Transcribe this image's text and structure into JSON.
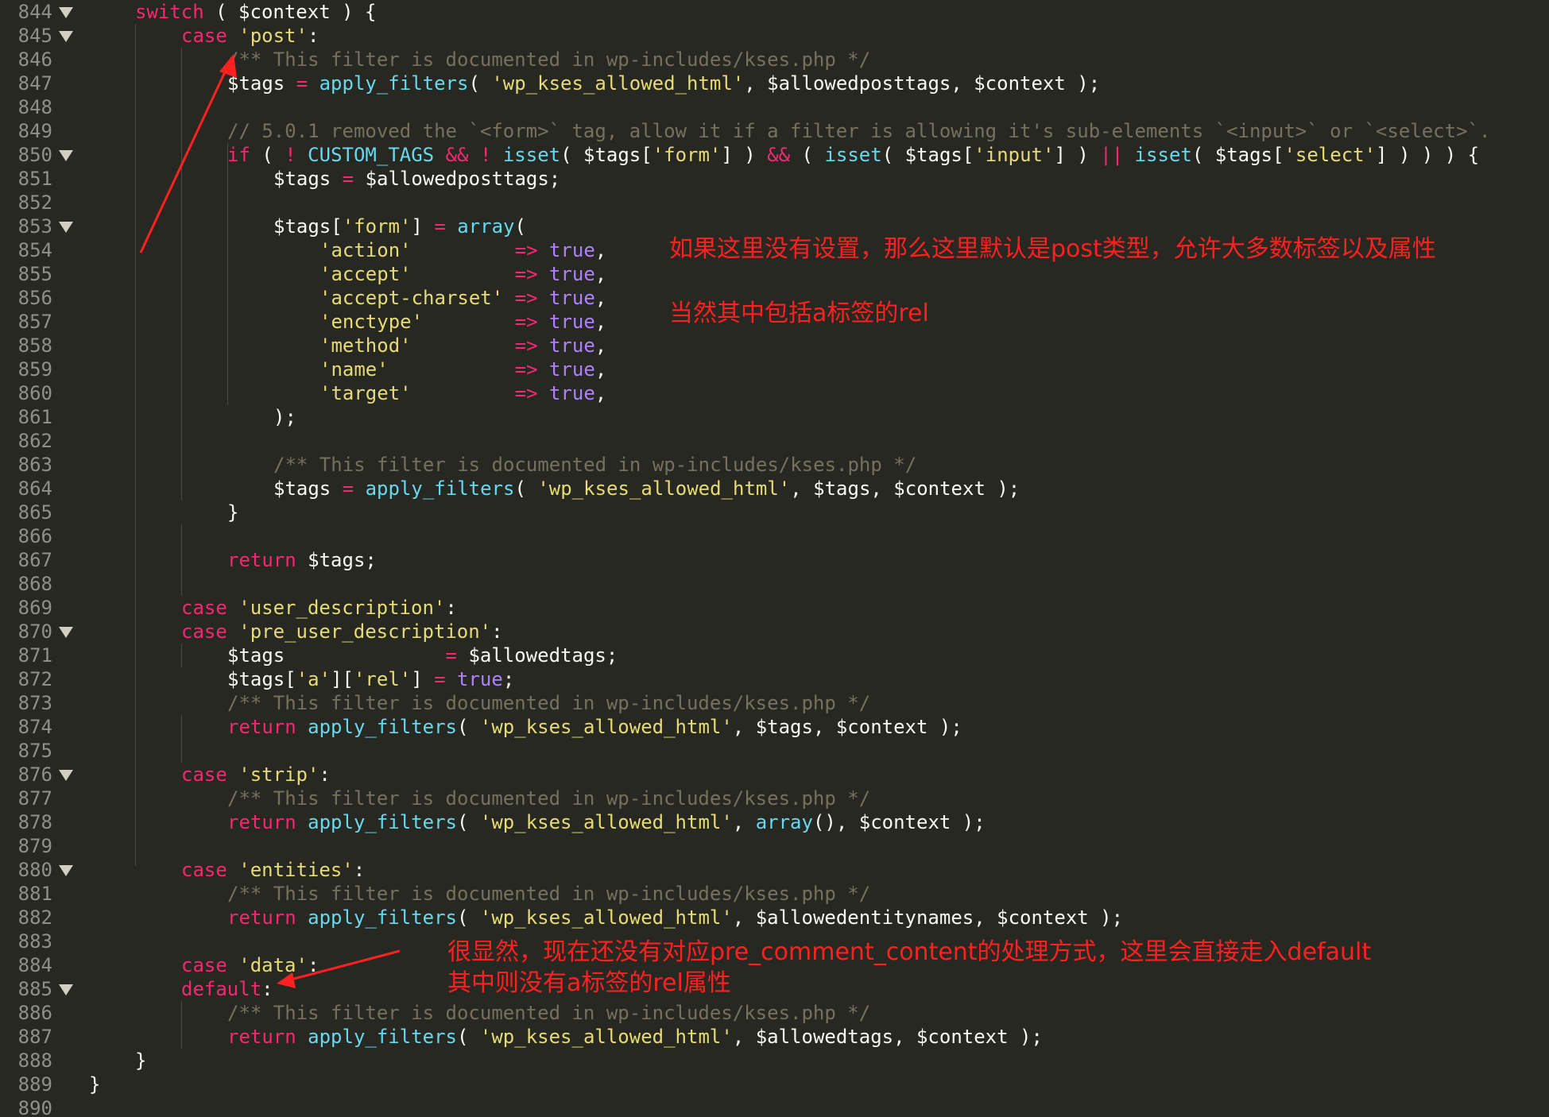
{
  "colors": {
    "background": "#272822",
    "line_number": "#90908a",
    "keyword": "#f92672",
    "string": "#e6db74",
    "function": "#66d9ef",
    "comment": "#75715e",
    "variable": "#f8f8f2",
    "constant": "#ae81ff",
    "annotation": "#ff2020"
  },
  "icons": {
    "fold_marker": "fold-triangle-down-icon",
    "annotation_arrow": "red-arrow-icon"
  },
  "lines": [
    {
      "n": "844",
      "fold": true,
      "tokens": [
        [
          "kw",
          "switch"
        ],
        [
          "var",
          " ( $context ) {"
        ]
      ]
    },
    {
      "n": "845",
      "fold": true,
      "tokens": [
        [
          "kw",
          "case"
        ],
        [
          "var",
          " "
        ],
        [
          "str",
          "'post'"
        ],
        [
          "var",
          ":"
        ]
      ]
    },
    {
      "n": "846",
      "fold": false,
      "tokens": [
        [
          "cm",
          "/** This filter is documented in wp-includes/kses.php */"
        ]
      ]
    },
    {
      "n": "847",
      "fold": false,
      "tokens": [
        [
          "var",
          "$tags "
        ],
        [
          "op",
          "="
        ],
        [
          "var",
          " "
        ],
        [
          "fn",
          "apply_filters"
        ],
        [
          "var",
          "( "
        ],
        [
          "str",
          "'wp_kses_allowed_html'"
        ],
        [
          "var",
          ", $allowedposttags, $context );"
        ]
      ]
    },
    {
      "n": "848",
      "fold": false,
      "tokens": []
    },
    {
      "n": "849",
      "fold": false,
      "tokens": [
        [
          "cm",
          "// 5.0.1 removed the `<form>` tag, allow it if a filter is allowing it's sub-elements `<input>` or `<select>`."
        ]
      ]
    },
    {
      "n": "850",
      "fold": true,
      "tokens": [
        [
          "kw",
          "if"
        ],
        [
          "var",
          " ( "
        ],
        [
          "op",
          "!"
        ],
        [
          "var",
          " "
        ],
        [
          "fn",
          "CUSTOM_TAGS"
        ],
        [
          "var",
          " "
        ],
        [
          "op",
          "&&"
        ],
        [
          "var",
          " "
        ],
        [
          "op",
          "!"
        ],
        [
          "var",
          " "
        ],
        [
          "fn",
          "isset"
        ],
        [
          "var",
          "( $tags["
        ],
        [
          "str",
          "'form'"
        ],
        [
          "var",
          "] ) "
        ],
        [
          "op",
          "&&"
        ],
        [
          "var",
          " ( "
        ],
        [
          "fn",
          "isset"
        ],
        [
          "var",
          "( $tags["
        ],
        [
          "str",
          "'input'"
        ],
        [
          "var",
          "] ) "
        ],
        [
          "op",
          "||"
        ],
        [
          "var",
          " "
        ],
        [
          "fn",
          "isset"
        ],
        [
          "var",
          "( $tags["
        ],
        [
          "str",
          "'select'"
        ],
        [
          "var",
          "] ) ) ) {"
        ]
      ]
    },
    {
      "n": "851",
      "fold": false,
      "tokens": [
        [
          "var",
          "$tags "
        ],
        [
          "op",
          "="
        ],
        [
          "var",
          " $allowedposttags;"
        ]
      ]
    },
    {
      "n": "852",
      "fold": false,
      "tokens": []
    },
    {
      "n": "853",
      "fold": true,
      "tokens": [
        [
          "var",
          "$tags["
        ],
        [
          "str",
          "'form'"
        ],
        [
          "var",
          "] "
        ],
        [
          "op",
          "="
        ],
        [
          "var",
          " "
        ],
        [
          "fn",
          "array"
        ],
        [
          "var",
          "("
        ]
      ]
    },
    {
      "n": "854",
      "fold": false,
      "tokens": [
        [
          "str",
          "'action'"
        ],
        [
          "var",
          "         "
        ],
        [
          "op",
          "=>"
        ],
        [
          "var",
          " "
        ],
        [
          "const",
          "true"
        ],
        [
          "var",
          ","
        ]
      ]
    },
    {
      "n": "855",
      "fold": false,
      "tokens": [
        [
          "str",
          "'accept'"
        ],
        [
          "var",
          "         "
        ],
        [
          "op",
          "=>"
        ],
        [
          "var",
          " "
        ],
        [
          "const",
          "true"
        ],
        [
          "var",
          ","
        ]
      ]
    },
    {
      "n": "856",
      "fold": false,
      "tokens": [
        [
          "str",
          "'accept-charset'"
        ],
        [
          "var",
          " "
        ],
        [
          "op",
          "=>"
        ],
        [
          "var",
          " "
        ],
        [
          "const",
          "true"
        ],
        [
          "var",
          ","
        ]
      ]
    },
    {
      "n": "857",
      "fold": false,
      "tokens": [
        [
          "str",
          "'enctype'"
        ],
        [
          "var",
          "        "
        ],
        [
          "op",
          "=>"
        ],
        [
          "var",
          " "
        ],
        [
          "const",
          "true"
        ],
        [
          "var",
          ","
        ]
      ]
    },
    {
      "n": "858",
      "fold": false,
      "tokens": [
        [
          "str",
          "'method'"
        ],
        [
          "var",
          "         "
        ],
        [
          "op",
          "=>"
        ],
        [
          "var",
          " "
        ],
        [
          "const",
          "true"
        ],
        [
          "var",
          ","
        ]
      ]
    },
    {
      "n": "859",
      "fold": false,
      "tokens": [
        [
          "str",
          "'name'"
        ],
        [
          "var",
          "           "
        ],
        [
          "op",
          "=>"
        ],
        [
          "var",
          " "
        ],
        [
          "const",
          "true"
        ],
        [
          "var",
          ","
        ]
      ]
    },
    {
      "n": "860",
      "fold": false,
      "tokens": [
        [
          "str",
          "'target'"
        ],
        [
          "var",
          "         "
        ],
        [
          "op",
          "=>"
        ],
        [
          "var",
          " "
        ],
        [
          "const",
          "true"
        ],
        [
          "var",
          ","
        ]
      ]
    },
    {
      "n": "861",
      "fold": false,
      "tokens": [
        [
          "var",
          ");"
        ]
      ]
    },
    {
      "n": "862",
      "fold": false,
      "tokens": []
    },
    {
      "n": "863",
      "fold": false,
      "tokens": [
        [
          "cm",
          "/** This filter is documented in wp-includes/kses.php */"
        ]
      ]
    },
    {
      "n": "864",
      "fold": false,
      "tokens": [
        [
          "var",
          "$tags "
        ],
        [
          "op",
          "="
        ],
        [
          "var",
          " "
        ],
        [
          "fn",
          "apply_filters"
        ],
        [
          "var",
          "( "
        ],
        [
          "str",
          "'wp_kses_allowed_html'"
        ],
        [
          "var",
          ", $tags, $context );"
        ]
      ]
    },
    {
      "n": "865",
      "fold": false,
      "tokens": [
        [
          "var",
          "}"
        ]
      ]
    },
    {
      "n": "866",
      "fold": false,
      "tokens": []
    },
    {
      "n": "867",
      "fold": false,
      "tokens": [
        [
          "kw",
          "return"
        ],
        [
          "var",
          " $tags;"
        ]
      ]
    },
    {
      "n": "868",
      "fold": false,
      "tokens": []
    },
    {
      "n": "869",
      "fold": false,
      "tokens": [
        [
          "kw",
          "case"
        ],
        [
          "var",
          " "
        ],
        [
          "str",
          "'user_description'"
        ],
        [
          "var",
          ":"
        ]
      ]
    },
    {
      "n": "870",
      "fold": true,
      "tokens": [
        [
          "kw",
          "case"
        ],
        [
          "var",
          " "
        ],
        [
          "str",
          "'pre_user_description'"
        ],
        [
          "var",
          ":"
        ]
      ]
    },
    {
      "n": "871",
      "fold": false,
      "tokens": [
        [
          "var",
          "$tags              "
        ],
        [
          "op",
          "="
        ],
        [
          "var",
          " $allowedtags;"
        ]
      ]
    },
    {
      "n": "872",
      "fold": false,
      "tokens": [
        [
          "var",
          "$tags["
        ],
        [
          "str",
          "'a'"
        ],
        [
          "var",
          "]["
        ],
        [
          "str",
          "'rel'"
        ],
        [
          "var",
          "] "
        ],
        [
          "op",
          "="
        ],
        [
          "var",
          " "
        ],
        [
          "const",
          "true"
        ],
        [
          "var",
          ";"
        ]
      ]
    },
    {
      "n": "873",
      "fold": false,
      "tokens": [
        [
          "cm",
          "/** This filter is documented in wp-includes/kses.php */"
        ]
      ]
    },
    {
      "n": "874",
      "fold": false,
      "tokens": [
        [
          "kw",
          "return"
        ],
        [
          "var",
          " "
        ],
        [
          "fn",
          "apply_filters"
        ],
        [
          "var",
          "( "
        ],
        [
          "str",
          "'wp_kses_allowed_html'"
        ],
        [
          "var",
          ", $tags, $context );"
        ]
      ]
    },
    {
      "n": "875",
      "fold": false,
      "tokens": []
    },
    {
      "n": "876",
      "fold": true,
      "tokens": [
        [
          "kw",
          "case"
        ],
        [
          "var",
          " "
        ],
        [
          "str",
          "'strip'"
        ],
        [
          "var",
          ":"
        ]
      ]
    },
    {
      "n": "877",
      "fold": false,
      "tokens": [
        [
          "cm",
          "/** This filter is documented in wp-includes/kses.php */"
        ]
      ]
    },
    {
      "n": "878",
      "fold": false,
      "tokens": [
        [
          "kw",
          "return"
        ],
        [
          "var",
          " "
        ],
        [
          "fn",
          "apply_filters"
        ],
        [
          "var",
          "( "
        ],
        [
          "str",
          "'wp_kses_allowed_html'"
        ],
        [
          "var",
          ", "
        ],
        [
          "fn",
          "array"
        ],
        [
          "var",
          "(), $context );"
        ]
      ]
    },
    {
      "n": "879",
      "fold": false,
      "tokens": []
    },
    {
      "n": "880",
      "fold": true,
      "tokens": [
        [
          "kw",
          "case"
        ],
        [
          "var",
          " "
        ],
        [
          "str",
          "'entities'"
        ],
        [
          "var",
          ":"
        ]
      ]
    },
    {
      "n": "881",
      "fold": false,
      "tokens": [
        [
          "cm",
          "/** This filter is documented in wp-includes/kses.php */"
        ]
      ]
    },
    {
      "n": "882",
      "fold": false,
      "tokens": [
        [
          "kw",
          "return"
        ],
        [
          "var",
          " "
        ],
        [
          "fn",
          "apply_filters"
        ],
        [
          "var",
          "( "
        ],
        [
          "str",
          "'wp_kses_allowed_html'"
        ],
        [
          "var",
          ", $allowedentitynames, $context );"
        ]
      ]
    },
    {
      "n": "883",
      "fold": false,
      "tokens": []
    },
    {
      "n": "884",
      "fold": false,
      "tokens": [
        [
          "kw",
          "case"
        ],
        [
          "var",
          " "
        ],
        [
          "str",
          "'data'"
        ],
        [
          "var",
          ":"
        ]
      ]
    },
    {
      "n": "885",
      "fold": true,
      "tokens": [
        [
          "kw",
          "default"
        ],
        [
          "var",
          ":"
        ]
      ]
    },
    {
      "n": "886",
      "fold": false,
      "tokens": [
        [
          "cm",
          "/** This filter is documented in wp-includes/kses.php */"
        ]
      ]
    },
    {
      "n": "887",
      "fold": false,
      "tokens": [
        [
          "kw",
          "return"
        ],
        [
          "var",
          " "
        ],
        [
          "fn",
          "apply_filters"
        ],
        [
          "var",
          "( "
        ],
        [
          "str",
          "'wp_kses_allowed_html'"
        ],
        [
          "var",
          ", $allowedtags, $context );"
        ]
      ]
    },
    {
      "n": "888",
      "fold": false,
      "tokens": [
        [
          "var",
          "}"
        ]
      ]
    },
    {
      "n": "889",
      "fold": false,
      "tokens": [
        [
          "var",
          "}"
        ]
      ]
    },
    {
      "n": "890",
      "fold": false,
      "tokens": []
    }
  ],
  "annotations": {
    "note1": "如果这里没有设置，那么这里默认是post类型，允许大多数标签以及属性",
    "note2": "当然其中包括a标签的rel",
    "note3_line1": "很显然，现在还没有对应pre_comment_content的处理方式，这里会直接走入default",
    "note3_line2": "其中则没有a标签的rel属性"
  }
}
